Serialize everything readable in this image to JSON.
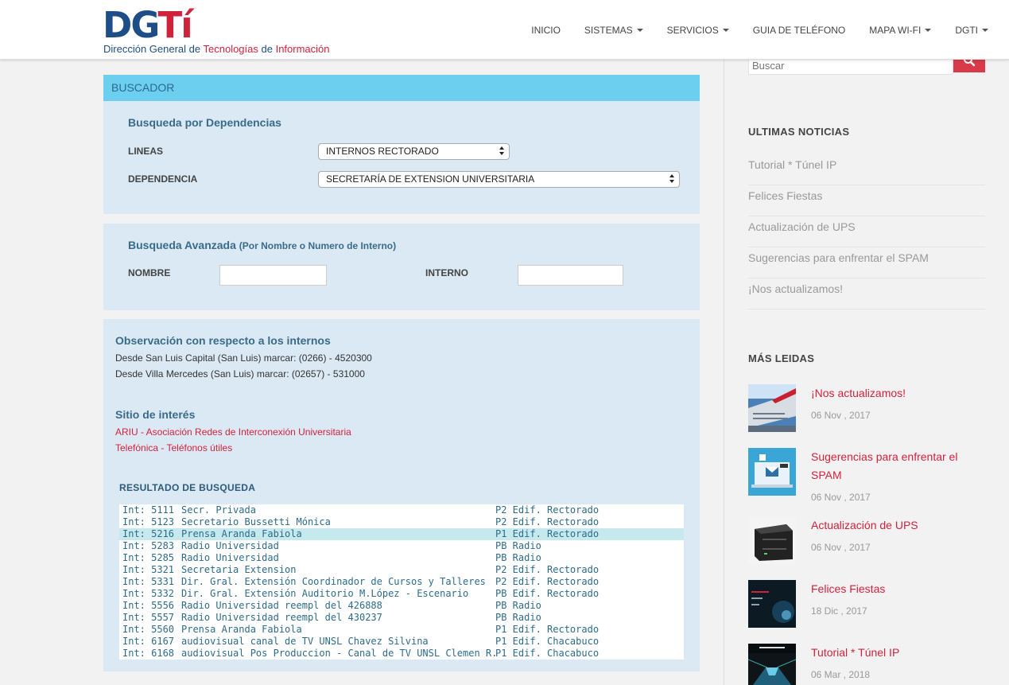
{
  "header": {
    "logo_dg": "DG",
    "logo_ti": "Tí",
    "logo_sub_1": "Dirección General de ",
    "logo_sub_2": "Tecnologías",
    "logo_sub_3": " de ",
    "logo_sub_4": "Información",
    "nav": [
      {
        "label": "INICIO",
        "dropdown": false
      },
      {
        "label": "SISTEMAS",
        "dropdown": true
      },
      {
        "label": "SERVICIOS",
        "dropdown": true
      },
      {
        "label": "GUIA DE TELÉFONO",
        "dropdown": false
      },
      {
        "label": "MAPA WI-FI",
        "dropdown": true
      },
      {
        "label": "DGTI",
        "dropdown": true
      }
    ]
  },
  "buscador": {
    "title": "BUSCADOR",
    "dependencias": {
      "title": "Busqueda por Dependencias",
      "lineas_label": "LINEAS",
      "lineas_value": "INTERNOS RECTORADO",
      "dependencia_label": "DEPENDENCIA",
      "dependencia_value": "SECRETARÍA DE EXTENSION UNIVERSITARIA"
    },
    "avanzada": {
      "title": "Busqueda Avanzada",
      "subtitle": "(Por Nombre o Numero de Interno)",
      "nombre_label": "NOMBRE",
      "nombre_value": "",
      "interno_label": "INTERNO",
      "interno_value": ""
    }
  },
  "observacion": {
    "title": "Observación con respecto a los internos",
    "line1": "Desde San Luis Capital (San Luis) marcar: (0266) - 4520300",
    "line2": "Desde Villa Mercedes (San Luis) marcar: (02657) - 531000"
  },
  "sitio": {
    "title": "Sitio de interés",
    "links": [
      "ARIU - Asociación Redes de Interconexión Universitaria",
      "Telefónica - Teléfonos útiles"
    ]
  },
  "resultado": {
    "title": "RESULTADO DE BUSQUEDA",
    "selected_index": 2,
    "rows": [
      {
        "int": "Int: 5111",
        "name": "Secr. Privada",
        "loc": "P2 Edif. Rectorado"
      },
      {
        "int": "Int: 5123",
        "name": "Secretario Bussetti Mónica",
        "loc": "P2 Edif. Rectorado"
      },
      {
        "int": "Int: 5216",
        "name": "Prensa Aranda Fabiola",
        "loc": "P1 Edif. Rectorado"
      },
      {
        "int": "Int: 5283",
        "name": "Radio Universidad",
        "loc": "PB Radio"
      },
      {
        "int": "Int: 5285",
        "name": "Radio Universidad",
        "loc": "PB Radio"
      },
      {
        "int": "Int: 5321",
        "name": "Secretaria Extension",
        "loc": "P2 Edif. Rectorado"
      },
      {
        "int": "Int: 5331",
        "name": "Dir. Gral. Extensión Coordinador de Cursos y Talleres",
        "loc": "P2 Edif. Rectorado"
      },
      {
        "int": "Int: 5332",
        "name": "Dir. Gral. Extensión Auditorio M.López - Escenario",
        "loc": "PB Edif. Rectorado"
      },
      {
        "int": "Int: 5556",
        "name": "Radio Universidad reempl del 426888",
        "loc": "PB Radio"
      },
      {
        "int": "Int: 5557",
        "name": "Radio Universidad reempl del 430237",
        "loc": "PB Radio"
      },
      {
        "int": "Int: 5560",
        "name": "Prensa Aranda Fabiola",
        "loc": "P1 Edif. Rectorado"
      },
      {
        "int": "Int: 6167",
        "name": "audiovisual canal de TV UNSL Chavez Silvina",
        "loc": "P1 Edif. Chacabuco"
      },
      {
        "int": "Int: 6168",
        "name": "audiovisual Pos Produccion - Canal de TV UNSL Clemen R.",
        "loc": "P1 Edif. Chacabuco"
      }
    ]
  },
  "sidebar": {
    "search_placeholder": "Buscar",
    "ultimas_title": "ULTIMAS NOTICIAS",
    "ultimas": [
      "Tutorial * Túnel IP",
      "Felices Fiestas",
      "Actualización de UPS",
      "Sugerencias para enfrentar el SPAM",
      "¡Nos actualizamos!"
    ],
    "mas_leidas_title": "MÁS LEIDAS",
    "mas_leidas": [
      {
        "title": "¡Nos actualizamos!",
        "date": "06 Nov , 2017",
        "thumb": "building"
      },
      {
        "title": "Sugerencias para enfrentar el SPAM",
        "date": "06 Nov , 2017",
        "thumb": "spam-laptop"
      },
      {
        "title": "Actualización de UPS",
        "date": "06 Nov , 2017",
        "thumb": "ups"
      },
      {
        "title": "Felices Fiestas",
        "date": "18 Dic , 2017",
        "thumb": "fiestas"
      },
      {
        "title": "Tutorial * Túnel IP",
        "date": "06 Mar , 2018",
        "thumb": "tunnel"
      }
    ]
  },
  "colors": {
    "brand_blue": "#1e4e88",
    "brand_red": "#d1223c",
    "bar_cyan": "#6dcff0",
    "panel_bg": "#dae9f3",
    "selected_row": "#c6e9ee"
  }
}
